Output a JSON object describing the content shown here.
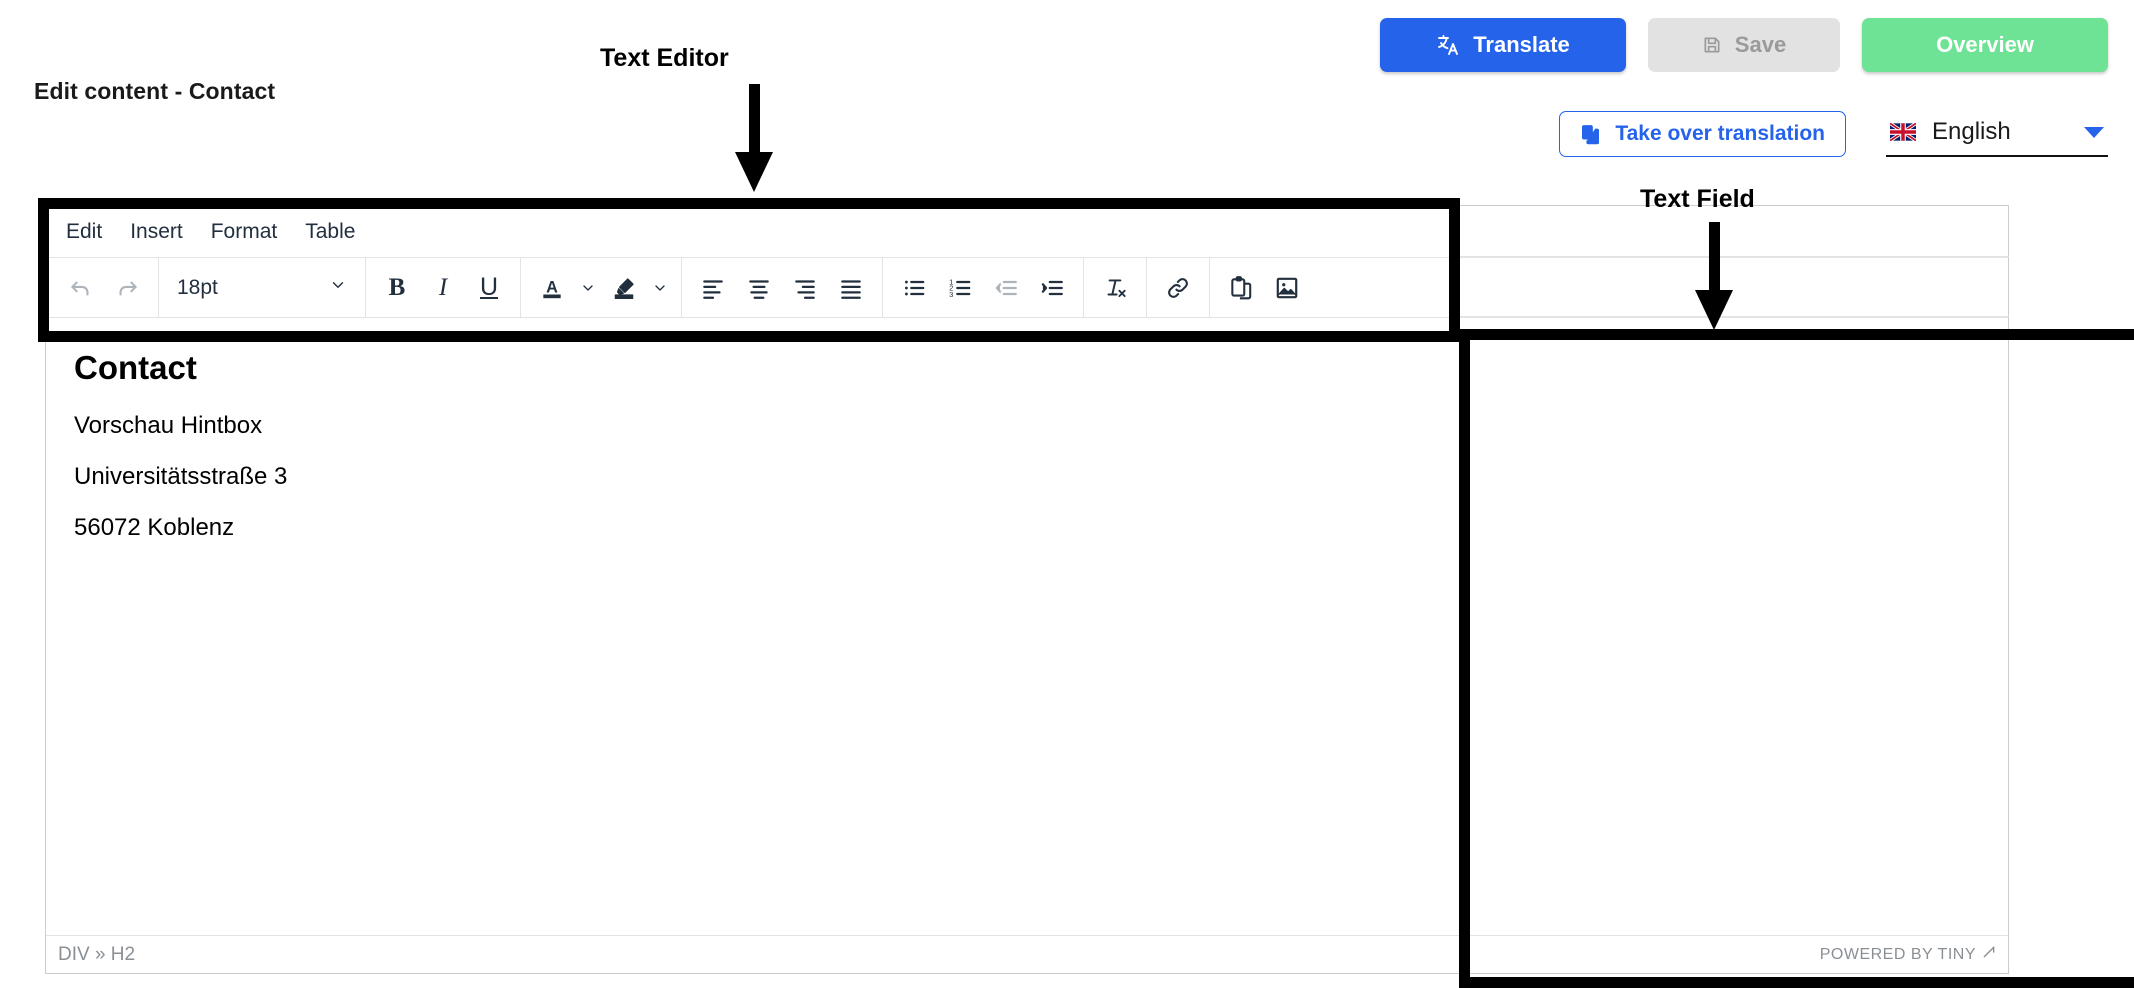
{
  "page": {
    "title": "Edit content - Contact"
  },
  "header": {
    "buttons": [
      {
        "id": "translate",
        "label": "Translate",
        "icon": "translate-icon",
        "color": "#2563eb"
      },
      {
        "id": "save",
        "label": "Save",
        "icon": "save-disk-icon",
        "color": "#e2e2e2",
        "disabled": true
      },
      {
        "id": "overview",
        "label": "Overview",
        "icon": "",
        "color": "#6ee295"
      }
    ],
    "takeover": {
      "label": "Take over translation",
      "icon": "copy-icon",
      "color": "#2563eb"
    },
    "language": {
      "value": "English",
      "flag": "uk-flag-icon",
      "caret": "chevron-down-icon"
    }
  },
  "annotations": [
    {
      "id": "text-editor",
      "label": "Text Editor"
    },
    {
      "id": "text-field",
      "label": "Text Field"
    }
  ],
  "editor": {
    "menu": [
      "Edit",
      "Insert",
      "Format",
      "Table"
    ],
    "toolbar": {
      "undo": "undo-icon",
      "redo": "redo-icon",
      "fontsize": "18pt",
      "bold": "B",
      "italic": "I",
      "underline": "U",
      "forecolor": "text-color-icon",
      "backcolor": "highlight-color-icon",
      "align_left": "align-left-icon",
      "align_center": "align-center-icon",
      "align_right": "align-right-icon",
      "align_justify": "align-justify-icon",
      "bullist": "bulleted-list-icon",
      "numlist": "numbered-list-icon",
      "outdent": "outdent-icon",
      "indent": "indent-icon",
      "removeformat": "remove-formatting-icon",
      "link": "link-icon",
      "paste": "paste-icon",
      "image": "image-icon"
    },
    "content": {
      "heading": "Contact",
      "paragraphs": [
        "Vorschau Hintbox",
        "Universitätsstraße 3",
        "56072 Koblenz"
      ]
    },
    "status": {
      "path": "DIV » H2",
      "branding": "POWERED BY TINY"
    }
  }
}
